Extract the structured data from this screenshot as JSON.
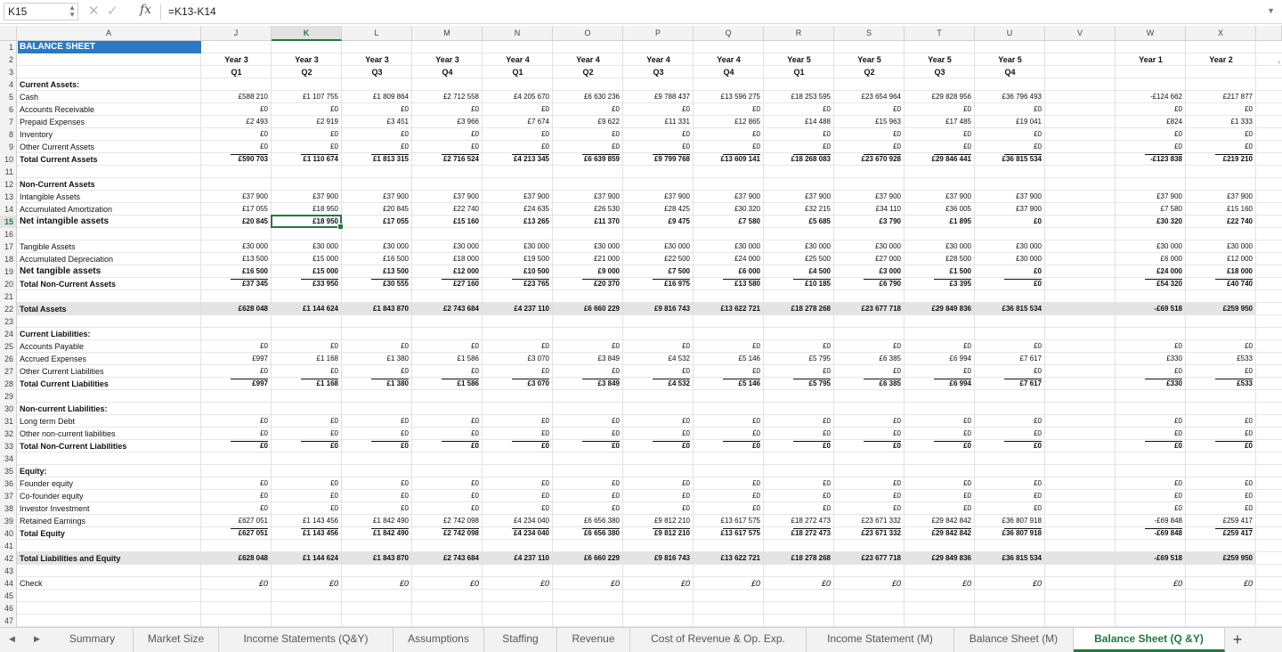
{
  "formula_bar": {
    "cell_ref": "K15",
    "cancel_glyph": "✕",
    "accept_glyph": "✓",
    "fx_label": "fx",
    "formula": "=K13-K14"
  },
  "grid": {
    "columns": [
      "A",
      "J",
      "K",
      "L",
      "M",
      "N",
      "O",
      "P",
      "Q",
      "R",
      "S",
      "T",
      "U",
      "V",
      "W",
      "X"
    ],
    "active_column": "K",
    "active_row": 15,
    "row_count": 47,
    "title": "BALANCE SHEET",
    "period_years": [
      "Year 3",
      "Year 3",
      "Year 3",
      "Year 3",
      "Year 4",
      "Year 4",
      "Year 4",
      "Year 4",
      "Year 5",
      "Year 5",
      "Year 5",
      "Year 5",
      "",
      "Year 1",
      "Year 2"
    ],
    "period_quarters": [
      "Q1",
      "Q2",
      "Q3",
      "Q4",
      "Q1",
      "Q2",
      "Q3",
      "Q4",
      "Q1",
      "Q2",
      "Q3",
      "Q4",
      "",
      "",
      ""
    ],
    "rows": [
      {
        "r": 4,
        "label": "Current Assets:",
        "style": "b"
      },
      {
        "r": 5,
        "label": "Cash",
        "values": [
          "£588 210",
          "£1 107 755",
          "£1 809 864",
          "£2 712 558",
          "£4 205 670",
          "£6 630 236",
          "£9 788 437",
          "£13 596 275",
          "£18 253 595",
          "£23 654 964",
          "£29 828 956",
          "£36 796 493",
          "",
          "-£124 662",
          "£217 877"
        ]
      },
      {
        "r": 6,
        "label": "Accounts Receivable",
        "values": [
          "£0",
          "£0",
          "£0",
          "£0",
          "£0",
          "£0",
          "£0",
          "£0",
          "£0",
          "£0",
          "£0",
          "£0",
          "",
          "£0",
          "£0"
        ]
      },
      {
        "r": 7,
        "label": "Prepaid Expenses",
        "values": [
          "£2 493",
          "£2 919",
          "£3 451",
          "£3 966",
          "£7 674",
          "£9 622",
          "£11 331",
          "£12 865",
          "£14 488",
          "£15 963",
          "£17 485",
          "£19 041",
          "",
          "£824",
          "£1 333"
        ]
      },
      {
        "r": 8,
        "label": "Inventory",
        "values": [
          "£0",
          "£0",
          "£0",
          "£0",
          "£0",
          "£0",
          "£0",
          "£0",
          "£0",
          "£0",
          "£0",
          "£0",
          "",
          "£0",
          "£0"
        ]
      },
      {
        "r": 9,
        "label": "Other Current Assets",
        "values": [
          "£0",
          "£0",
          "£0",
          "£0",
          "£0",
          "£0",
          "£0",
          "£0",
          "£0",
          "£0",
          "£0",
          "£0",
          "",
          "£0",
          "£0"
        ]
      },
      {
        "r": 10,
        "label": "Total Current Assets",
        "style": "b",
        "total": true,
        "values": [
          "£590 703",
          "£1 110 674",
          "£1 813 315",
          "£2 716 524",
          "£4 213 345",
          "£6 639 859",
          "£9 799 768",
          "£13 609 141",
          "£18 268 083",
          "£23 670 928",
          "£29 846 441",
          "£36 815 534",
          "",
          "-£123 838",
          "£219 210"
        ]
      },
      {
        "r": 12,
        "label": "Non-Current Assets",
        "style": "b"
      },
      {
        "r": 13,
        "label": "Intangible Assets",
        "values": [
          "£37 900",
          "£37 900",
          "£37 900",
          "£37 900",
          "£37 900",
          "£37 900",
          "£37 900",
          "£37 900",
          "£37 900",
          "£37 900",
          "£37 900",
          "£37 900",
          "",
          "£37 900",
          "£37 900"
        ]
      },
      {
        "r": 14,
        "label": "Accumulated Amortization",
        "values": [
          "£17 055",
          "£18 950",
          "£20 845",
          "£22 740",
          "£24 635",
          "£26 530",
          "£28 425",
          "£30 320",
          "£32 215",
          "£34 110",
          "£36 005",
          "£37 900",
          "",
          "£7 580",
          "£15 160"
        ]
      },
      {
        "r": 15,
        "label": "Net intangible assets",
        "style": "sb",
        "values": [
          "£20 845",
          "£18 950",
          "£17 055",
          "£15 160",
          "£13 265",
          "£11 370",
          "£9 475",
          "£7 580",
          "£5 685",
          "£3 790",
          "£1 895",
          "£0",
          "",
          "£30 320",
          "£22 740"
        ],
        "vstyle": "b"
      },
      {
        "r": 17,
        "label": "Tangible Assets",
        "values": [
          "£30 000",
          "£30 000",
          "£30 000",
          "£30 000",
          "£30 000",
          "£30 000",
          "£30 000",
          "£30 000",
          "£30 000",
          "£30 000",
          "£30 000",
          "£30 000",
          "",
          "£30 000",
          "£30 000"
        ]
      },
      {
        "r": 18,
        "label": "Accumulated Depreciation",
        "values": [
          "£13 500",
          "£15 000",
          "£16 500",
          "£18 000",
          "£19 500",
          "£21 000",
          "£22 500",
          "£24 000",
          "£25 500",
          "£27 000",
          "£28 500",
          "£30 000",
          "",
          "£6 000",
          "£12 000"
        ]
      },
      {
        "r": 19,
        "label": "Net tangible assets",
        "style": "sb",
        "values": [
          "£16 500",
          "£15 000",
          "£13 500",
          "£12 000",
          "£10 500",
          "£9 000",
          "£7 500",
          "£6 000",
          "£4 500",
          "£3 000",
          "£1 500",
          "£0",
          "",
          "£24 000",
          "£18 000"
        ]
      },
      {
        "r": 20,
        "label": "Total Non-Current Assets",
        "style": "b",
        "total": true,
        "values": [
          "£37 345",
          "£33 950",
          "£30 555",
          "£27 160",
          "£23 765",
          "£20 370",
          "£16 975",
          "£13 580",
          "£10 185",
          "£6 790",
          "£3 395",
          "£0",
          "",
          "£54 320",
          "£40 740"
        ]
      },
      {
        "r": 22,
        "label": "Total Assets",
        "style": "b",
        "shade": true,
        "values": [
          "£628 048",
          "£1 144 624",
          "£1 843 870",
          "£2 743 684",
          "£4 237 110",
          "£6 660 229",
          "£9 816 743",
          "£13 622 721",
          "£18 278 268",
          "£23 677 718",
          "£29 849 836",
          "£36 815 534",
          "",
          "-£69 518",
          "£259 950"
        ]
      },
      {
        "r": 24,
        "label": "Current Liabilities:",
        "style": "b"
      },
      {
        "r": 25,
        "label": "Accounts Payable",
        "values": [
          "£0",
          "£0",
          "£0",
          "£0",
          "£0",
          "£0",
          "£0",
          "£0",
          "£0",
          "£0",
          "£0",
          "£0",
          "",
          "£0",
          "£0"
        ]
      },
      {
        "r": 26,
        "label": "Accrued Expenses",
        "values": [
          "£997",
          "£1 168",
          "£1 380",
          "£1 586",
          "£3 070",
          "£3 849",
          "£4 532",
          "£5 146",
          "£5 795",
          "£6 385",
          "£6 994",
          "£7 617",
          "",
          "£330",
          "£533"
        ]
      },
      {
        "r": 27,
        "label": "Other Current Liabilities",
        "values": [
          "£0",
          "£0",
          "£0",
          "£0",
          "£0",
          "£0",
          "£0",
          "£0",
          "£0",
          "£0",
          "£0",
          "£0",
          "",
          "£0",
          "£0"
        ]
      },
      {
        "r": 28,
        "label": "Total Current Liabilities",
        "style": "b",
        "total": true,
        "values": [
          "£997",
          "£1 168",
          "£1 380",
          "£1 586",
          "£3 070",
          "£3 849",
          "£4 532",
          "£5 146",
          "£5 795",
          "£6 385",
          "£6 994",
          "£7 617",
          "",
          "£330",
          "£533"
        ]
      },
      {
        "r": 30,
        "label": "Non-current Liabilities:",
        "style": "b"
      },
      {
        "r": 31,
        "label": "Long term Debt",
        "values": [
          "£0",
          "£0",
          "£0",
          "£0",
          "£0",
          "£0",
          "£0",
          "£0",
          "£0",
          "£0",
          "£0",
          "£0",
          "",
          "£0",
          "£0"
        ]
      },
      {
        "r": 32,
        "label": "Other non-current liabilities",
        "values": [
          "£0",
          "£0",
          "£0",
          "£0",
          "£0",
          "£0",
          "£0",
          "£0",
          "£0",
          "£0",
          "£0",
          "£0",
          "",
          "£0",
          "£0"
        ]
      },
      {
        "r": 33,
        "label": "Total Non-Current Liabilities",
        "style": "b",
        "total": true,
        "values": [
          "£0",
          "£0",
          "£0",
          "£0",
          "£0",
          "£0",
          "£0",
          "£0",
          "£0",
          "£0",
          "£0",
          "£0",
          "",
          "£0",
          "£0"
        ]
      },
      {
        "r": 35,
        "label": "Equity:",
        "style": "b"
      },
      {
        "r": 36,
        "label": "Founder equity",
        "values": [
          "£0",
          "£0",
          "£0",
          "£0",
          "£0",
          "£0",
          "£0",
          "£0",
          "£0",
          "£0",
          "£0",
          "£0",
          "",
          "£0",
          "£0"
        ]
      },
      {
        "r": 37,
        "label": "Co-founder equity",
        "values": [
          "£0",
          "£0",
          "£0",
          "£0",
          "£0",
          "£0",
          "£0",
          "£0",
          "£0",
          "£0",
          "£0",
          "£0",
          "",
          "£0",
          "£0"
        ]
      },
      {
        "r": 38,
        "label": "Investor Investment",
        "values": [
          "£0",
          "£0",
          "£0",
          "£0",
          "£0",
          "£0",
          "£0",
          "£0",
          "£0",
          "£0",
          "£0",
          "£0",
          "",
          "£0",
          "£0"
        ]
      },
      {
        "r": 39,
        "label": "Retained Earnings",
        "values": [
          "£627 051",
          "£1 143 456",
          "£1 842 490",
          "£2 742 098",
          "£4 234 040",
          "£6 656 380",
          "£9 812 210",
          "£13 617 575",
          "£18 272 473",
          "£23 671 332",
          "£29 842 842",
          "£36 807 918",
          "",
          "-£69 848",
          "£259 417"
        ]
      },
      {
        "r": 40,
        "label": "Total Equity",
        "style": "b",
        "total": true,
        "values": [
          "£627 051",
          "£1 143 456",
          "£1 842 490",
          "£2 742 098",
          "£4 234 040",
          "£6 656 380",
          "£9 812 210",
          "£13 617 575",
          "£18 272 473",
          "£23 671 332",
          "£29 842 842",
          "£36 807 918",
          "",
          "-£69 848",
          "£259 417"
        ]
      },
      {
        "r": 42,
        "label": "Total Liabilities and Equity",
        "style": "b",
        "shade": true,
        "values": [
          "£628 048",
          "£1 144 624",
          "£1 843 870",
          "£2 743 684",
          "£4 237 110",
          "£6 660 229",
          "£9 816 743",
          "£13 622 721",
          "£18 278 268",
          "£23 677 718",
          "£29 849 836",
          "£36 815 534",
          "",
          "-£69 518",
          "£259 950"
        ]
      },
      {
        "r": 44,
        "label": "Check",
        "vstyle": "i",
        "values": [
          "£0",
          "£0",
          "£0",
          "£0",
          "£0",
          "£0",
          "£0",
          "£0",
          "£0",
          "£0",
          "£0",
          "£0",
          "",
          "£0",
          "£0"
        ]
      }
    ]
  },
  "sheet_tabs": {
    "prev_glyph": "◀",
    "next_glyph": "▶",
    "tabs": [
      "Summary",
      "Market Size",
      "Income Statements (Q&Y)",
      "Assumptions",
      "Staffing",
      "Revenue",
      "Cost of Revenue & Op. Exp.",
      "Income Statement (M)",
      "Balance Sheet (M)",
      "Balance Sheet (Q &Y)"
    ],
    "active": "Balance Sheet (Q &Y)",
    "add_label": "+"
  },
  "colors": {
    "accent": "#1f7a3f",
    "title_fill": "#2b79c3",
    "shade": "#e4e4e4"
  }
}
